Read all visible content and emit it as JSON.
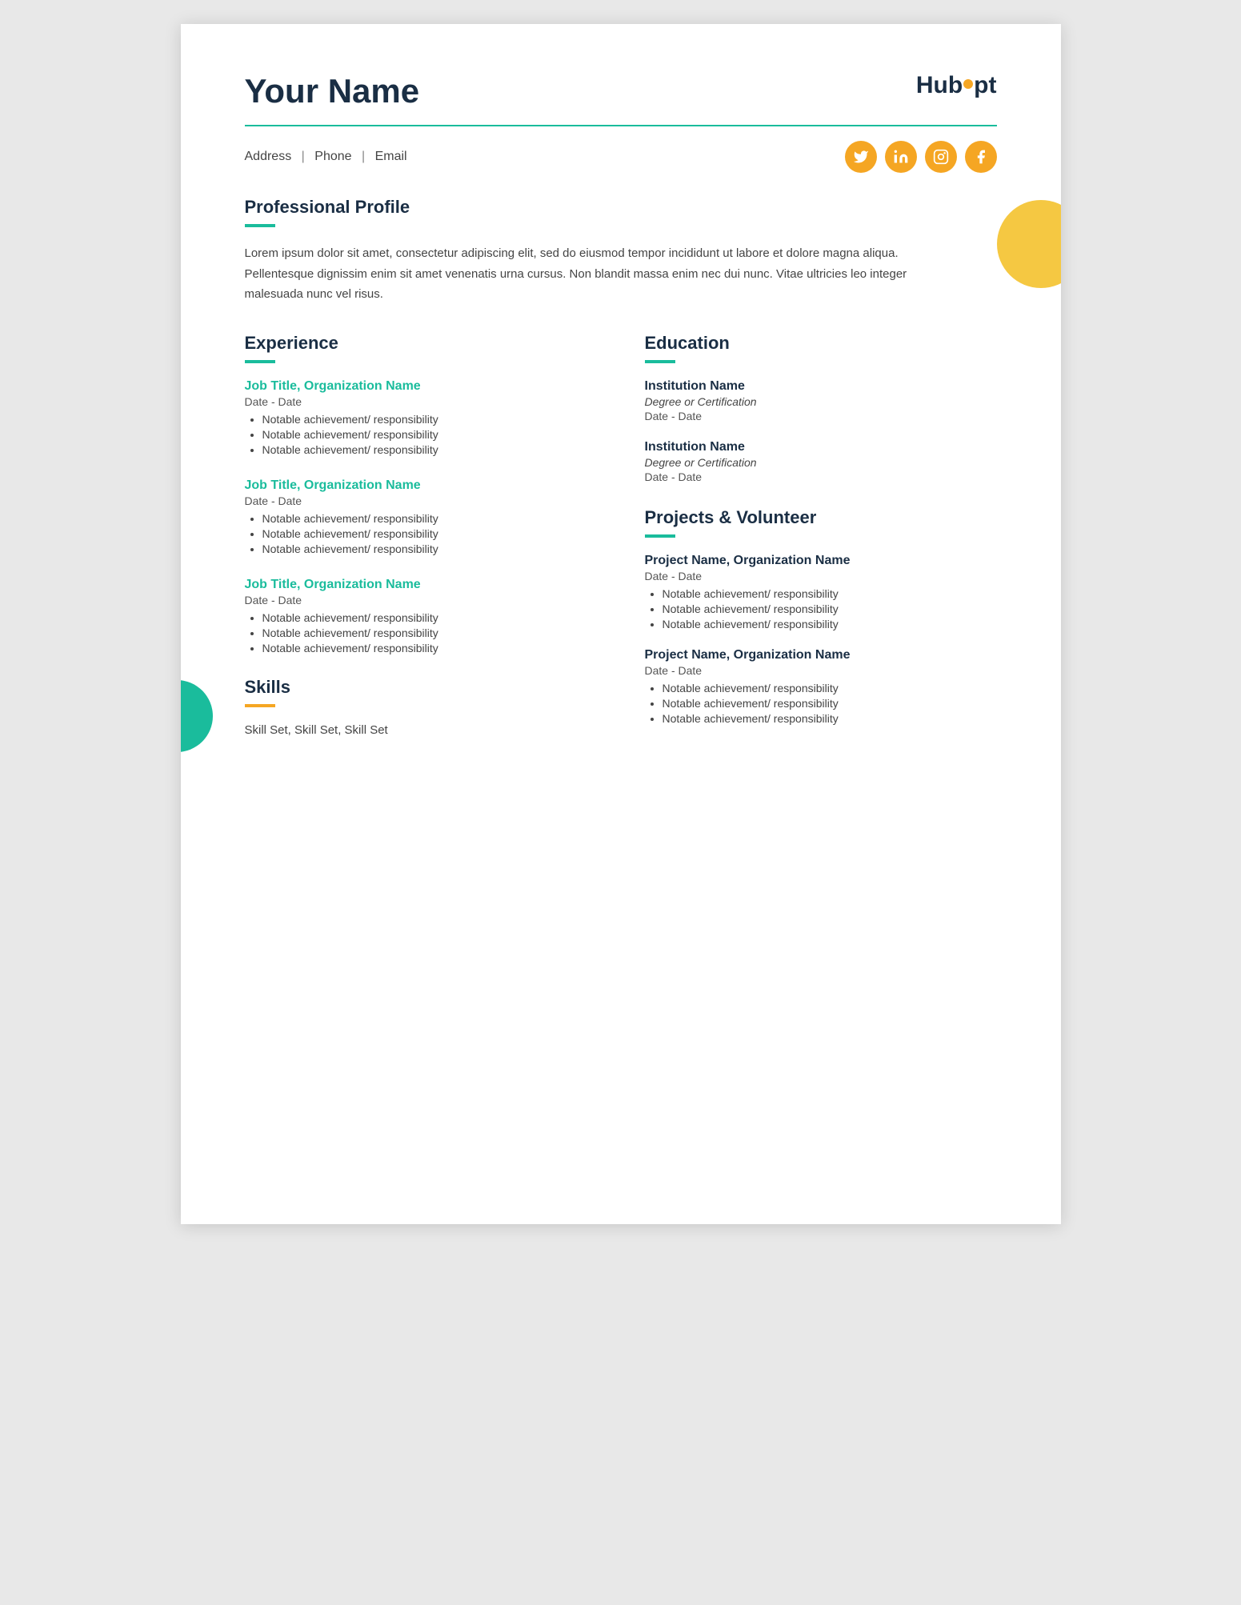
{
  "header": {
    "name": "Your Name",
    "logo_text_1": "Hub",
    "logo_text_2": "p",
    "logo_text_3": "t"
  },
  "contact": {
    "address": "Address",
    "phone": "Phone",
    "email": "Email",
    "sep": "|"
  },
  "social": {
    "icons": [
      "twitter",
      "linkedin",
      "instagram",
      "facebook"
    ]
  },
  "profile": {
    "title": "Professional Profile",
    "text": "Lorem ipsum dolor sit amet, consectetur adipiscing elit, sed do eiusmod tempor incididunt ut labore et dolore magna aliqua. Pellentesque dignissim enim sit amet venenatis urna cursus. Non blandit massa enim nec dui nunc. Vitae ultricies leo integer malesuada nunc vel risus."
  },
  "experience": {
    "title": "Experience",
    "jobs": [
      {
        "title": "Job Title, Organization Name",
        "date": "Date - Date",
        "achievements": [
          "Notable achievement/ responsibility",
          "Notable achievement/ responsibility",
          "Notable achievement/ responsibility"
        ]
      },
      {
        "title": "Job Title, Organization Name",
        "date": "Date - Date",
        "achievements": [
          "Notable achievement/ responsibility",
          "Notable achievement/ responsibility",
          "Notable achievement/ responsibility"
        ]
      },
      {
        "title": "Job Title, Organization Name",
        "date": "Date - Date",
        "achievements": [
          "Notable achievement/ responsibility",
          "Notable achievement/ responsibility",
          "Notable achievement/ responsibility"
        ]
      }
    ]
  },
  "education": {
    "title": "Education",
    "entries": [
      {
        "institution": "Institution Name",
        "degree": "Degree or Certification",
        "date": "Date - Date"
      },
      {
        "institution": "Institution Name",
        "degree": "Degree or Certification",
        "date": "Date - Date"
      }
    ]
  },
  "projects": {
    "title": "Projects & Volunteer",
    "entries": [
      {
        "title": "Project Name, Organization Name",
        "date": "Date - Date",
        "achievements": [
          "Notable achievement/ responsibility",
          "Notable achievement/ responsibility",
          "Notable achievement/ responsibility"
        ]
      },
      {
        "title": "Project Name, Organization Name",
        "date": "Date - Date",
        "achievements": [
          "Notable achievement/ responsibility",
          "Notable achievement/ responsibility",
          "Notable achievement/ responsibility"
        ]
      }
    ]
  },
  "skills": {
    "title": "Skills",
    "text": "Skill Set, Skill Set, Skill Set"
  }
}
